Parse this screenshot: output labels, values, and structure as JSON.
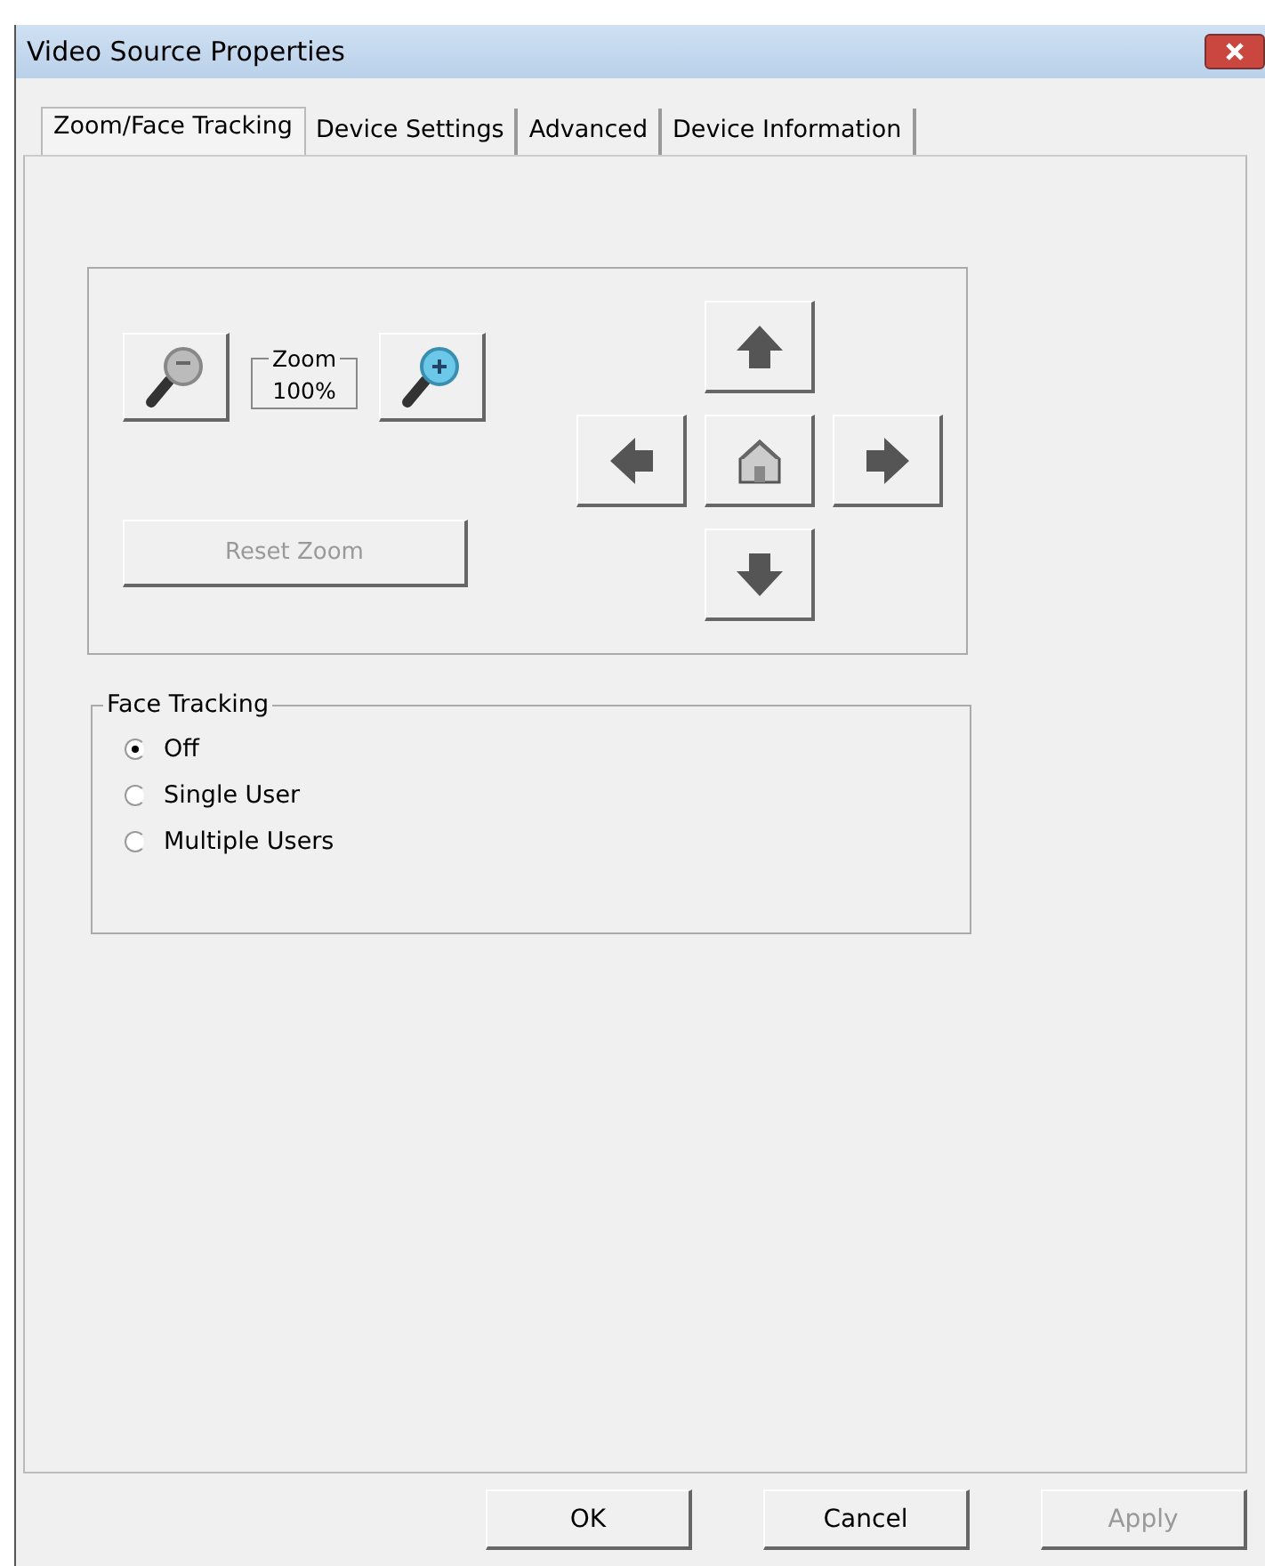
{
  "window": {
    "title": "Video Source Properties"
  },
  "tabs": [
    {
      "label": "Zoom/Face Tracking",
      "selected": true
    },
    {
      "label": "Device Settings",
      "selected": false
    },
    {
      "label": "Advanced",
      "selected": false
    },
    {
      "label": "Device Information",
      "selected": false
    }
  ],
  "zoom": {
    "label": "Zoom",
    "value": "100%",
    "reset_button": {
      "label": "Reset Zoom",
      "disabled": true
    }
  },
  "pan_controls": [
    {
      "kind": "up"
    },
    {
      "kind": "left"
    },
    {
      "kind": "home"
    },
    {
      "kind": "right"
    },
    {
      "kind": "down"
    }
  ],
  "face_tracking": {
    "title": "Face Tracking",
    "options": [
      {
        "label": "Off",
        "selected": true
      },
      {
        "label": "Single User",
        "selected": false
      },
      {
        "label": "Multiple Users",
        "selected": false
      }
    ]
  },
  "buttons": [
    {
      "label": "OK",
      "disabled": false
    },
    {
      "label": "Cancel",
      "disabled": false
    },
    {
      "label": "Apply",
      "disabled": true
    }
  ]
}
